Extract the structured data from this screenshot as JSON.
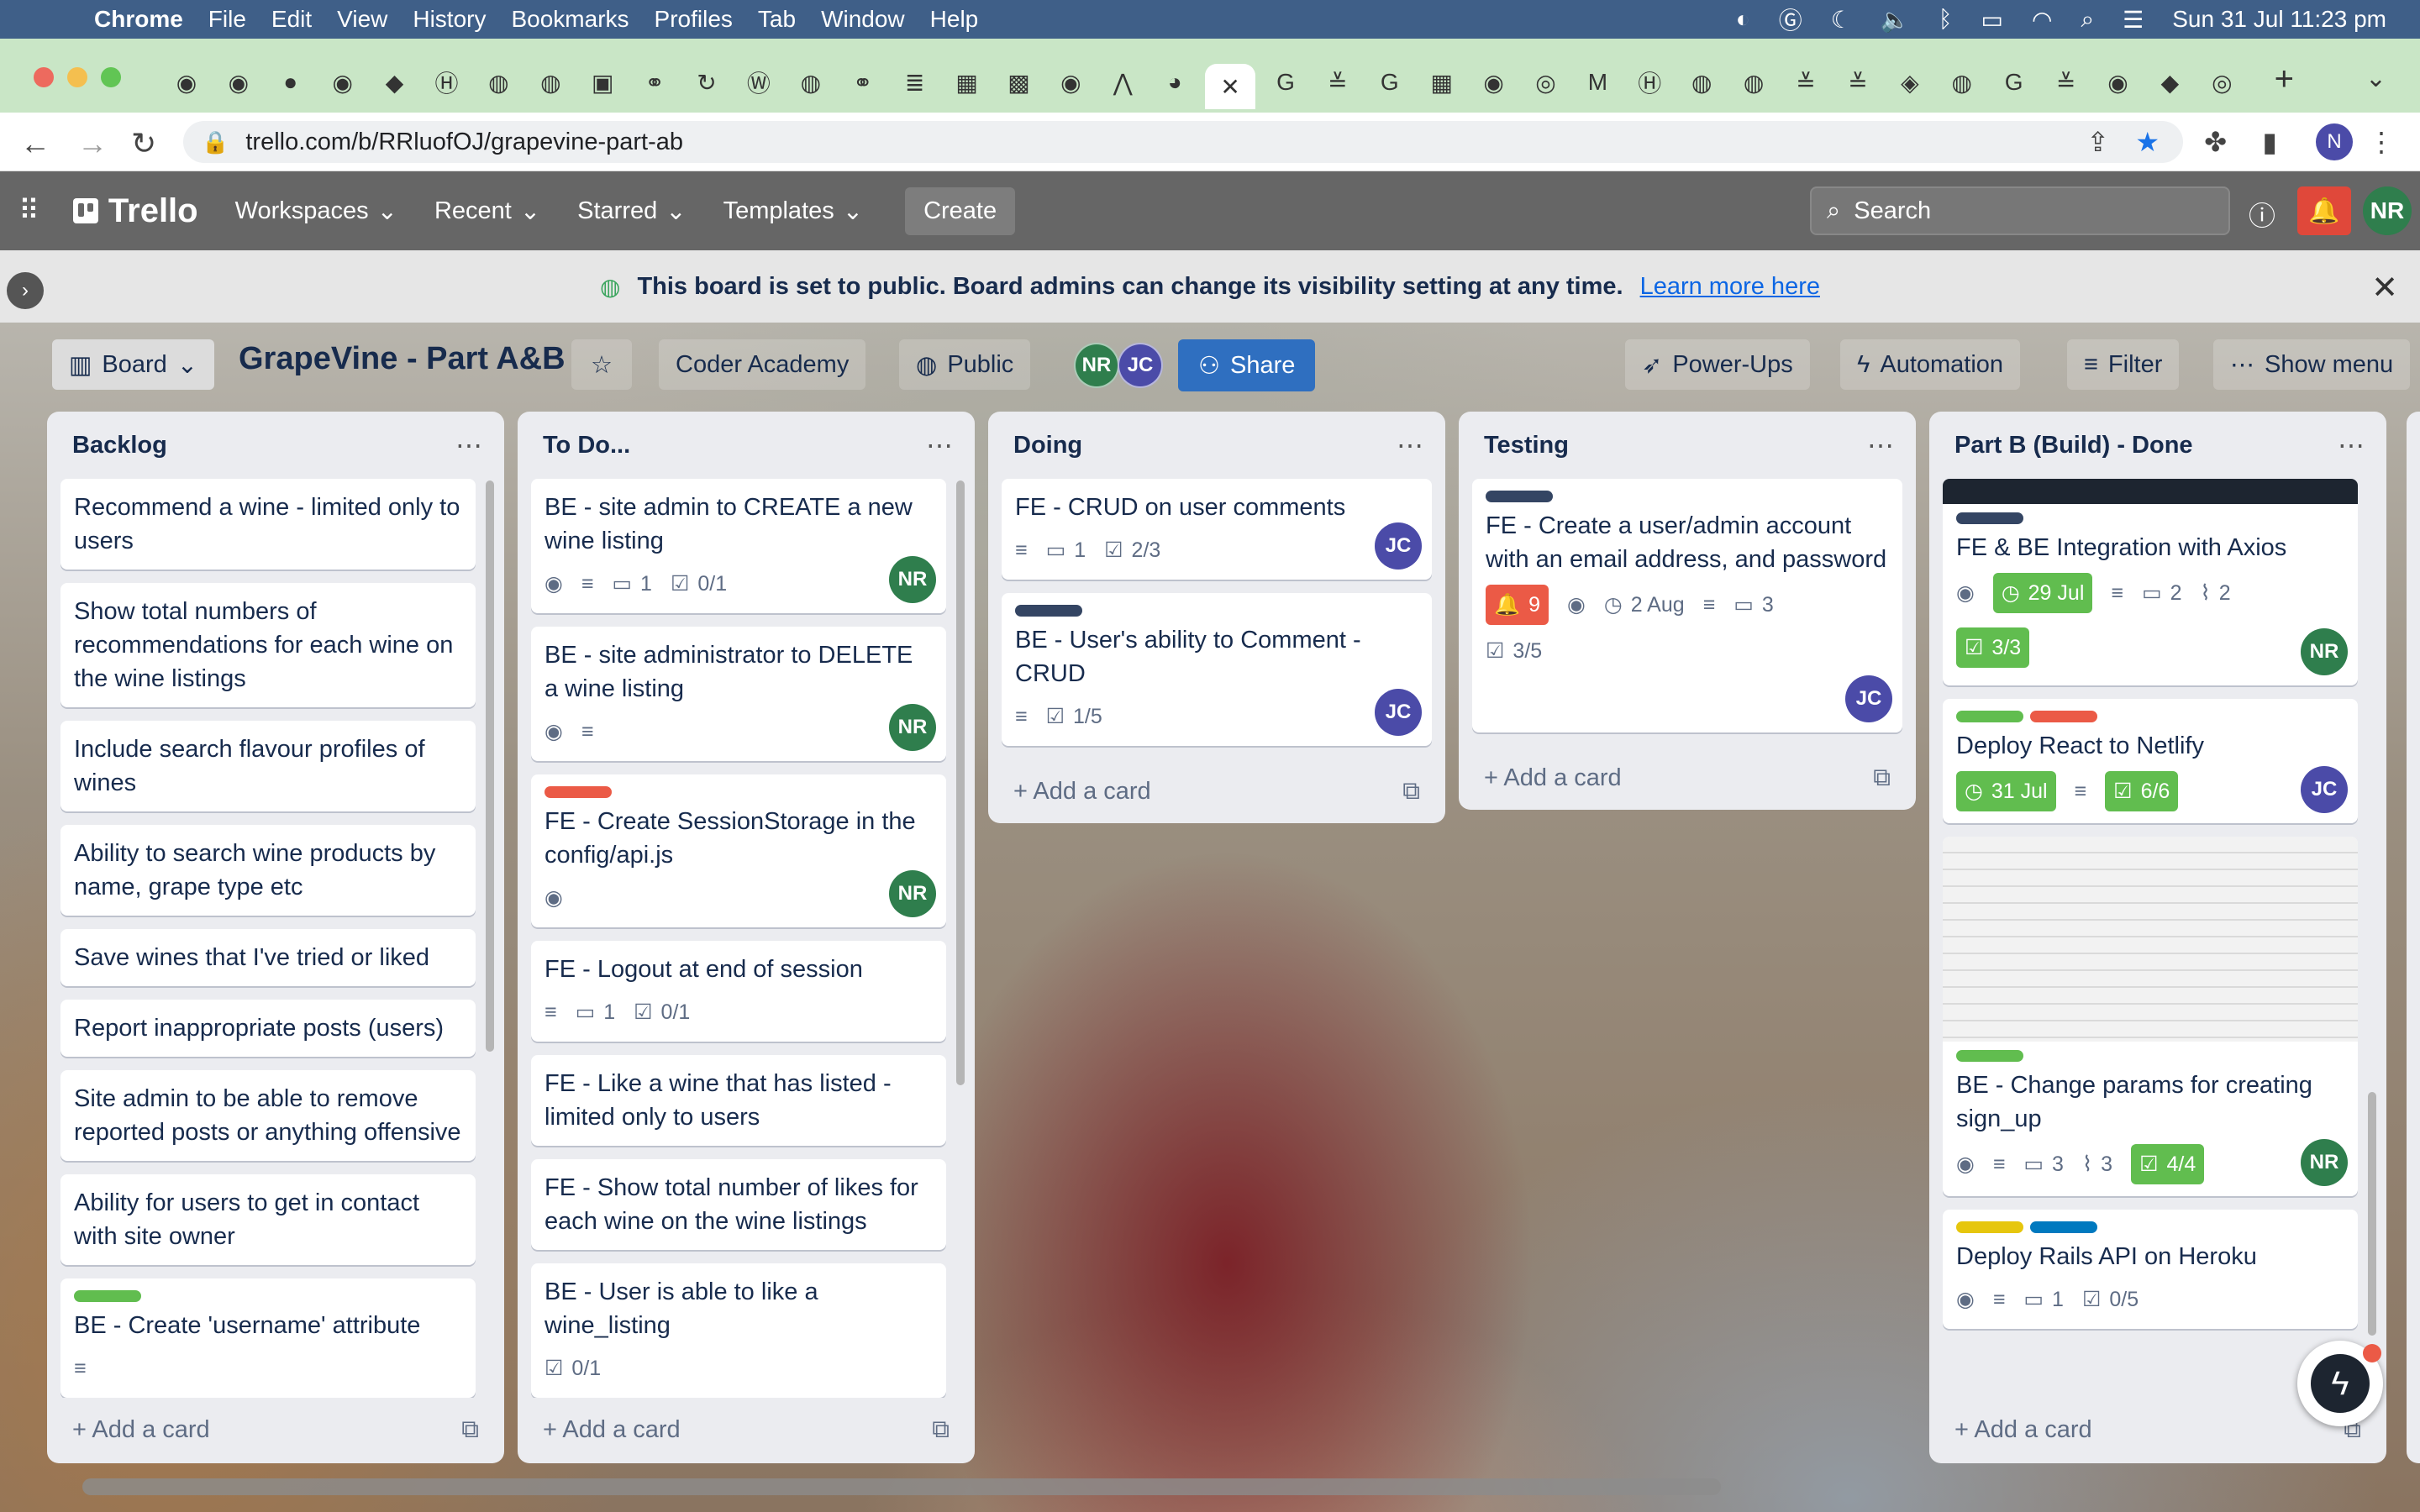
{
  "os_menubar": {
    "app": "Chrome",
    "items": [
      "File",
      "Edit",
      "View",
      "History",
      "Bookmarks",
      "Profiles",
      "Tab",
      "Window",
      "Help"
    ],
    "clock": "Sun 31 Jul  11:23 pm"
  },
  "browser": {
    "url": "trello.com/b/RRluofOJ/grapevine-part-ab",
    "profile_initial": "N"
  },
  "trello_header": {
    "logo": "Trello",
    "nav": [
      "Workspaces",
      "Recent",
      "Starred",
      "Templates"
    ],
    "create": "Create",
    "search_placeholder": "Search",
    "user_initials": "NR"
  },
  "banner": {
    "message": "This board is set to public. Board admins can change its visibility setting at any time.",
    "link": "Learn more here"
  },
  "board": {
    "view": "Board",
    "title": "GrapeVine - Part A&B",
    "workspace": "Coder Academy",
    "visibility": "Public",
    "members": [
      "NR",
      "JC"
    ],
    "share": "Share",
    "power_ups": "Power-Ups",
    "automation": "Automation",
    "filter": "Filter",
    "show_menu": "Show menu",
    "add_card": "Add a card"
  },
  "colors": {
    "green_label": "#61bd4f",
    "red_label": "#eb5a46",
    "dark_label": "#344563",
    "yellow_label": "#e6c60d",
    "blue_label": "#0079bf",
    "nr_avatar": "#2f7e4d",
    "jc_avatar": "#4b4ba8"
  },
  "lists": [
    {
      "title": "Backlog",
      "cards": [
        {
          "title": "Recommend a wine - limited only to users"
        },
        {
          "title": "Show total numbers of recommendations for each wine on the wine listings"
        },
        {
          "title": "Include search flavour profiles of wines"
        },
        {
          "title": "Ability to search wine products by name, grape type etc"
        },
        {
          "title": "Save wines that I've tried or liked"
        },
        {
          "title": "Report inappropriate posts (users)"
        },
        {
          "title": "Site admin to be able to remove reported posts or anything offensive"
        },
        {
          "title": "Ability for users to get in contact with site owner"
        },
        {
          "title": "BE - Create 'username' attribute"
        }
      ]
    },
    {
      "title": "To Do...",
      "cards": [
        {
          "title": "BE - site admin to CREATE a new wine listing",
          "comments": "1",
          "checklist": "0/1",
          "member": "NR"
        },
        {
          "title": "BE - site administrator to DELETE a wine listing",
          "member": "NR"
        },
        {
          "title": "FE - Create SessionStorage in the config/api.js",
          "member": "NR"
        },
        {
          "title": "FE - Logout at end of session",
          "comments": "1",
          "checklist": "0/1"
        },
        {
          "title": "FE - Like a wine that has listed - limited only to users"
        },
        {
          "title": "FE - Show total number of likes for each wine on the wine listings"
        },
        {
          "title": "BE - User is able to like a wine_listing",
          "checklist": "0/1"
        }
      ]
    },
    {
      "title": "Doing",
      "cards": [
        {
          "title": "FE - CRUD on user comments",
          "comments": "1",
          "checklist": "2/3",
          "member": "JC"
        },
        {
          "title": "BE - User's ability to Comment - CRUD",
          "checklist": "1/5",
          "member": "JC"
        }
      ]
    },
    {
      "title": "Testing",
      "cards": [
        {
          "title": "FE - Create a user/admin account with an email address, and password",
          "notifications": "9",
          "due": "2 Aug",
          "comments": "3",
          "checklist": "3/5",
          "member": "JC"
        }
      ]
    },
    {
      "title": "Part B (Build) - Done",
      "cards": [
        {
          "title": "FE & BE Integration with Axios",
          "due": "29 Jul",
          "comments": "2",
          "attachments": "2",
          "checklist": "3/3",
          "member": "NR"
        },
        {
          "title": "Deploy React to Netlify",
          "due": "31 Jul",
          "checklist": "6/6",
          "member": "JC"
        },
        {
          "title": "BE - Change params for creating sign_up",
          "comments": "3",
          "attachments": "3",
          "checklist": "4/4",
          "member": "NR"
        },
        {
          "title": "Deploy Rails API on Heroku",
          "comments": "1",
          "checklist": "0/5"
        }
      ]
    }
  ]
}
